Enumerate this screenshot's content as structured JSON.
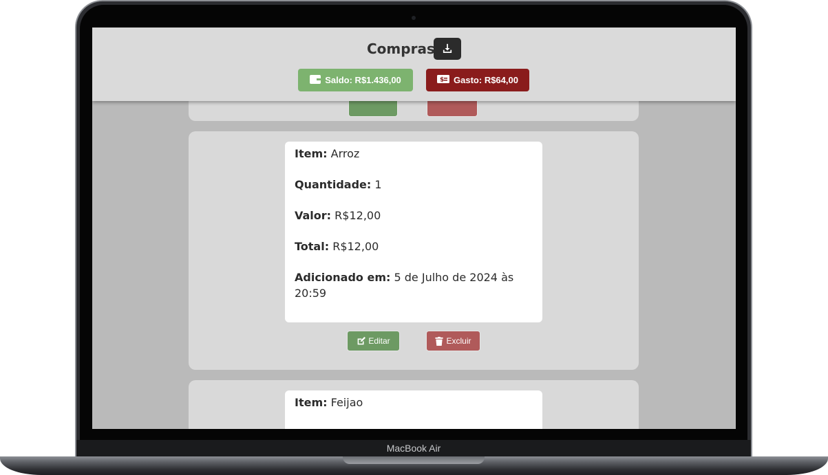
{
  "device": {
    "brand_label": "MacBook Air"
  },
  "header": {
    "title": "Compras",
    "saldo_label": "Saldo: R$1.436,00",
    "gasto_label": "Gasto: R$64,00",
    "icons": {
      "download": "download-icon",
      "wallet": "wallet-icon",
      "money": "money-bill-icon"
    },
    "colors": {
      "saldo": "#7db36f",
      "gasto": "#8a1c1c",
      "download": "#2b2b2b"
    }
  },
  "items": [
    {
      "item_label": "Item:",
      "item_value": "Arroz",
      "quantity_label": "Quantidade:",
      "quantity_value": "1",
      "price_label": "Valor:",
      "price_value": "R$12,00",
      "total_label": "Total:",
      "total_value": "R$12,00",
      "added_label": "Adicionado em:",
      "added_value": "5 de Julho de 2024 às 20:59",
      "edit_label": "Editar",
      "delete_label": "Excluir"
    },
    {
      "item_label": "Item:",
      "item_value": "Feijao"
    }
  ]
}
